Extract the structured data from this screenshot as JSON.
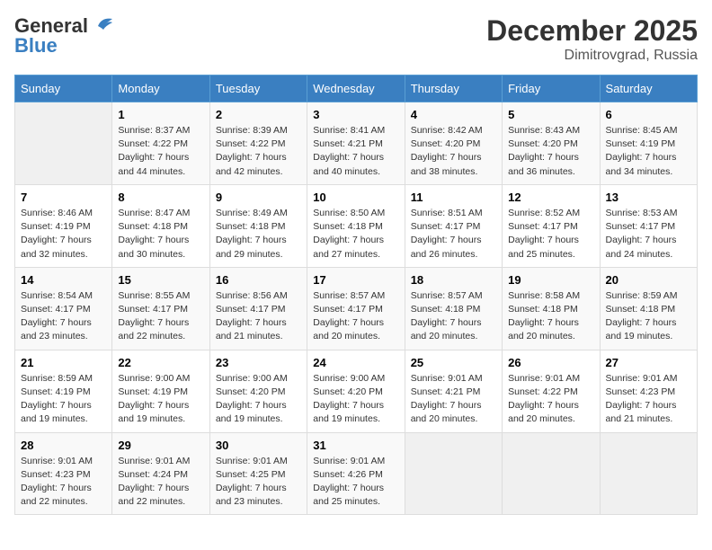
{
  "header": {
    "logo_general": "General",
    "logo_blue": "Blue",
    "month": "December 2025",
    "location": "Dimitrovgrad, Russia"
  },
  "weekdays": [
    "Sunday",
    "Monday",
    "Tuesday",
    "Wednesday",
    "Thursday",
    "Friday",
    "Saturday"
  ],
  "weeks": [
    [
      {
        "day": "",
        "sunrise": "",
        "sunset": "",
        "daylight": ""
      },
      {
        "day": "1",
        "sunrise": "Sunrise: 8:37 AM",
        "sunset": "Sunset: 4:22 PM",
        "daylight": "Daylight: 7 hours and 44 minutes."
      },
      {
        "day": "2",
        "sunrise": "Sunrise: 8:39 AM",
        "sunset": "Sunset: 4:22 PM",
        "daylight": "Daylight: 7 hours and 42 minutes."
      },
      {
        "day": "3",
        "sunrise": "Sunrise: 8:41 AM",
        "sunset": "Sunset: 4:21 PM",
        "daylight": "Daylight: 7 hours and 40 minutes."
      },
      {
        "day": "4",
        "sunrise": "Sunrise: 8:42 AM",
        "sunset": "Sunset: 4:20 PM",
        "daylight": "Daylight: 7 hours and 38 minutes."
      },
      {
        "day": "5",
        "sunrise": "Sunrise: 8:43 AM",
        "sunset": "Sunset: 4:20 PM",
        "daylight": "Daylight: 7 hours and 36 minutes."
      },
      {
        "day": "6",
        "sunrise": "Sunrise: 8:45 AM",
        "sunset": "Sunset: 4:19 PM",
        "daylight": "Daylight: 7 hours and 34 minutes."
      }
    ],
    [
      {
        "day": "7",
        "sunrise": "Sunrise: 8:46 AM",
        "sunset": "Sunset: 4:19 PM",
        "daylight": "Daylight: 7 hours and 32 minutes."
      },
      {
        "day": "8",
        "sunrise": "Sunrise: 8:47 AM",
        "sunset": "Sunset: 4:18 PM",
        "daylight": "Daylight: 7 hours and 30 minutes."
      },
      {
        "day": "9",
        "sunrise": "Sunrise: 8:49 AM",
        "sunset": "Sunset: 4:18 PM",
        "daylight": "Daylight: 7 hours and 29 minutes."
      },
      {
        "day": "10",
        "sunrise": "Sunrise: 8:50 AM",
        "sunset": "Sunset: 4:18 PM",
        "daylight": "Daylight: 7 hours and 27 minutes."
      },
      {
        "day": "11",
        "sunrise": "Sunrise: 8:51 AM",
        "sunset": "Sunset: 4:17 PM",
        "daylight": "Daylight: 7 hours and 26 minutes."
      },
      {
        "day": "12",
        "sunrise": "Sunrise: 8:52 AM",
        "sunset": "Sunset: 4:17 PM",
        "daylight": "Daylight: 7 hours and 25 minutes."
      },
      {
        "day": "13",
        "sunrise": "Sunrise: 8:53 AM",
        "sunset": "Sunset: 4:17 PM",
        "daylight": "Daylight: 7 hours and 24 minutes."
      }
    ],
    [
      {
        "day": "14",
        "sunrise": "Sunrise: 8:54 AM",
        "sunset": "Sunset: 4:17 PM",
        "daylight": "Daylight: 7 hours and 23 minutes."
      },
      {
        "day": "15",
        "sunrise": "Sunrise: 8:55 AM",
        "sunset": "Sunset: 4:17 PM",
        "daylight": "Daylight: 7 hours and 22 minutes."
      },
      {
        "day": "16",
        "sunrise": "Sunrise: 8:56 AM",
        "sunset": "Sunset: 4:17 PM",
        "daylight": "Daylight: 7 hours and 21 minutes."
      },
      {
        "day": "17",
        "sunrise": "Sunrise: 8:57 AM",
        "sunset": "Sunset: 4:17 PM",
        "daylight": "Daylight: 7 hours and 20 minutes."
      },
      {
        "day": "18",
        "sunrise": "Sunrise: 8:57 AM",
        "sunset": "Sunset: 4:18 PM",
        "daylight": "Daylight: 7 hours and 20 minutes."
      },
      {
        "day": "19",
        "sunrise": "Sunrise: 8:58 AM",
        "sunset": "Sunset: 4:18 PM",
        "daylight": "Daylight: 7 hours and 20 minutes."
      },
      {
        "day": "20",
        "sunrise": "Sunrise: 8:59 AM",
        "sunset": "Sunset: 4:18 PM",
        "daylight": "Daylight: 7 hours and 19 minutes."
      }
    ],
    [
      {
        "day": "21",
        "sunrise": "Sunrise: 8:59 AM",
        "sunset": "Sunset: 4:19 PM",
        "daylight": "Daylight: 7 hours and 19 minutes."
      },
      {
        "day": "22",
        "sunrise": "Sunrise: 9:00 AM",
        "sunset": "Sunset: 4:19 PM",
        "daylight": "Daylight: 7 hours and 19 minutes."
      },
      {
        "day": "23",
        "sunrise": "Sunrise: 9:00 AM",
        "sunset": "Sunset: 4:20 PM",
        "daylight": "Daylight: 7 hours and 19 minutes."
      },
      {
        "day": "24",
        "sunrise": "Sunrise: 9:00 AM",
        "sunset": "Sunset: 4:20 PM",
        "daylight": "Daylight: 7 hours and 19 minutes."
      },
      {
        "day": "25",
        "sunrise": "Sunrise: 9:01 AM",
        "sunset": "Sunset: 4:21 PM",
        "daylight": "Daylight: 7 hours and 20 minutes."
      },
      {
        "day": "26",
        "sunrise": "Sunrise: 9:01 AM",
        "sunset": "Sunset: 4:22 PM",
        "daylight": "Daylight: 7 hours and 20 minutes."
      },
      {
        "day": "27",
        "sunrise": "Sunrise: 9:01 AM",
        "sunset": "Sunset: 4:23 PM",
        "daylight": "Daylight: 7 hours and 21 minutes."
      }
    ],
    [
      {
        "day": "28",
        "sunrise": "Sunrise: 9:01 AM",
        "sunset": "Sunset: 4:23 PM",
        "daylight": "Daylight: 7 hours and 22 minutes."
      },
      {
        "day": "29",
        "sunrise": "Sunrise: 9:01 AM",
        "sunset": "Sunset: 4:24 PM",
        "daylight": "Daylight: 7 hours and 22 minutes."
      },
      {
        "day": "30",
        "sunrise": "Sunrise: 9:01 AM",
        "sunset": "Sunset: 4:25 PM",
        "daylight": "Daylight: 7 hours and 23 minutes."
      },
      {
        "day": "31",
        "sunrise": "Sunrise: 9:01 AM",
        "sunset": "Sunset: 4:26 PM",
        "daylight": "Daylight: 7 hours and 25 minutes."
      },
      {
        "day": "",
        "sunrise": "",
        "sunset": "",
        "daylight": ""
      },
      {
        "day": "",
        "sunrise": "",
        "sunset": "",
        "daylight": ""
      },
      {
        "day": "",
        "sunrise": "",
        "sunset": "",
        "daylight": ""
      }
    ]
  ]
}
